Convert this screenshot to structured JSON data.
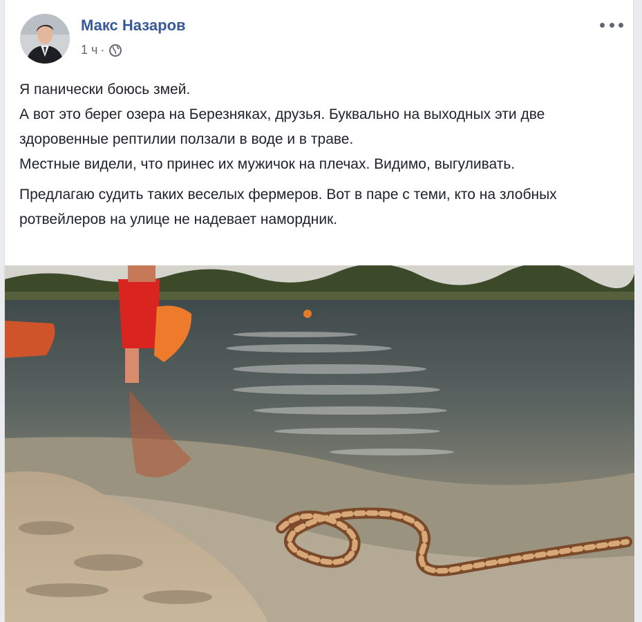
{
  "post": {
    "author": "Макс Назаров",
    "time": "1 ч",
    "separator": "·",
    "privacy_icon": "globe-icon",
    "more_icon": "more-options-icon",
    "paragraphs": [
      "Я панически боюсь змей.\nА вот это берег озера на Березняках, друзья. Буквально на выходных эти две здоровенные рептилии ползали в воде и в траве.\nМестные видели, что принес их мужичок на плечах. Видимо, выгуливать.",
      "Предлагаю судить таких веселых фермеров. Вот в паре с теми, кто на злобных ротвейлеров на улице не надевает намордник."
    ]
  },
  "colors": {
    "author_link": "#385898",
    "meta_text": "#606770",
    "body_text": "#1d2129"
  }
}
